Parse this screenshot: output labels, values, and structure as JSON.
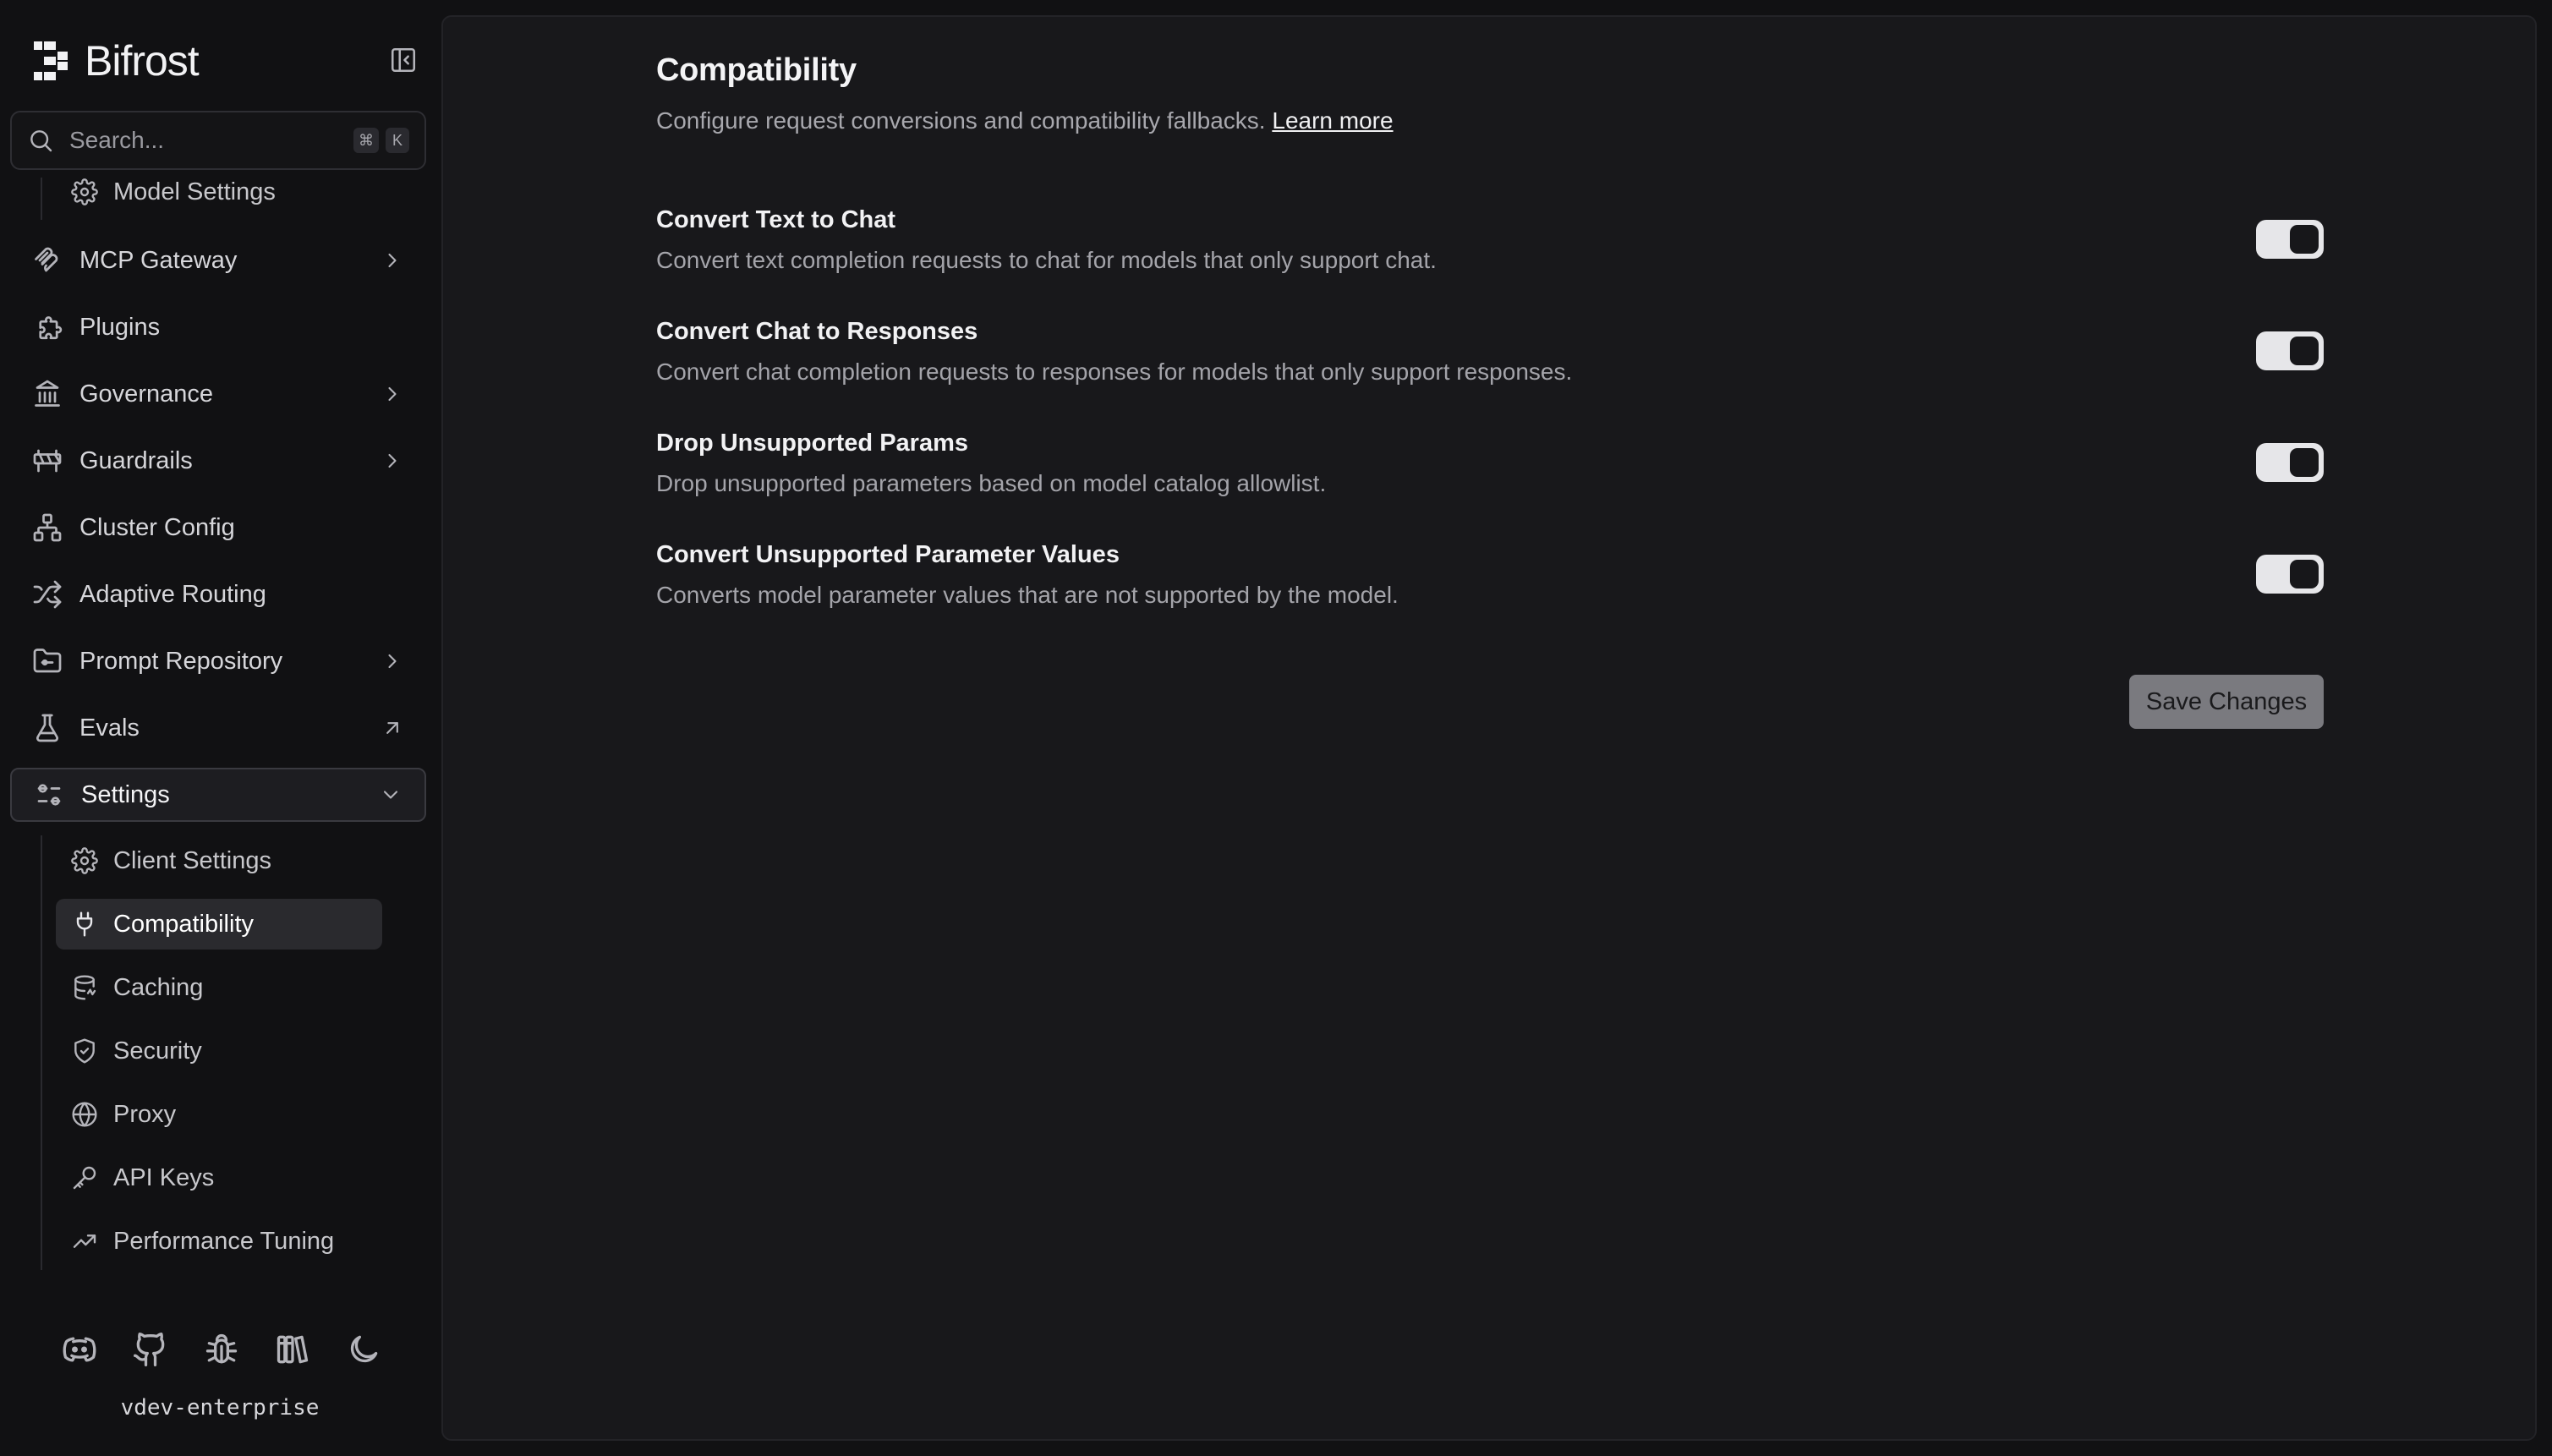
{
  "app": {
    "name": "Bifrost",
    "version": "vdev-enterprise"
  },
  "search": {
    "placeholder": "Search...",
    "shortcut": [
      "⌘",
      "K"
    ]
  },
  "sidebar": {
    "top_sub_item": {
      "label": "Model Settings",
      "icon": "gear-icon"
    },
    "items": [
      {
        "label": "MCP Gateway",
        "icon": "mcp-icon",
        "chevron": "right"
      },
      {
        "label": "Plugins",
        "icon": "puzzle-icon",
        "chevron": ""
      },
      {
        "label": "Governance",
        "icon": "landmark-icon",
        "chevron": "right"
      },
      {
        "label": "Guardrails",
        "icon": "barrier-icon",
        "chevron": "right"
      },
      {
        "label": "Cluster Config",
        "icon": "network-icon",
        "chevron": ""
      },
      {
        "label": "Adaptive Routing",
        "icon": "shuffle-icon",
        "chevron": ""
      },
      {
        "label": "Prompt Repository",
        "icon": "folder-code-icon",
        "chevron": "right"
      },
      {
        "label": "Evals",
        "icon": "flask-icon",
        "chevron": "external"
      },
      {
        "label": "Settings",
        "icon": "sliders-icon",
        "chevron": "down",
        "active": true
      }
    ],
    "settings_children": [
      {
        "label": "Client Settings",
        "icon": "gear-icon"
      },
      {
        "label": "Compatibility",
        "icon": "plug-icon",
        "active": true
      },
      {
        "label": "Caching",
        "icon": "database-icon"
      },
      {
        "label": "Security",
        "icon": "shield-check-icon"
      },
      {
        "label": "Proxy",
        "icon": "globe-icon"
      },
      {
        "label": "API Keys",
        "icon": "key-icon"
      },
      {
        "label": "Performance Tuning",
        "icon": "trending-up-icon"
      }
    ],
    "footer_icons": [
      "discord-icon",
      "github-icon",
      "bug-icon",
      "docs-icon",
      "moon-icon"
    ]
  },
  "main": {
    "title": "Compatibility",
    "description": "Configure request conversions and compatibility fallbacks.",
    "learn_more": "Learn more",
    "settings": [
      {
        "title": "Convert Text to Chat",
        "description": "Convert text completion requests to chat for models that only support chat.",
        "enabled": true
      },
      {
        "title": "Convert Chat to Responses",
        "description": "Convert chat completion requests to responses for models that only support responses.",
        "enabled": true
      },
      {
        "title": "Drop Unsupported Params",
        "description": "Drop unsupported parameters based on model catalog allowlist.",
        "enabled": true
      },
      {
        "title": "Convert Unsupported Parameter Values",
        "description": "Converts model parameter values that are not supported by the model.",
        "enabled": true
      }
    ],
    "save_label": "Save Changes"
  },
  "colors": {
    "background": "#111113",
    "panel": "#18181b",
    "toggle_on": "#e6e6e9",
    "save_button": "#7a7a7f"
  }
}
